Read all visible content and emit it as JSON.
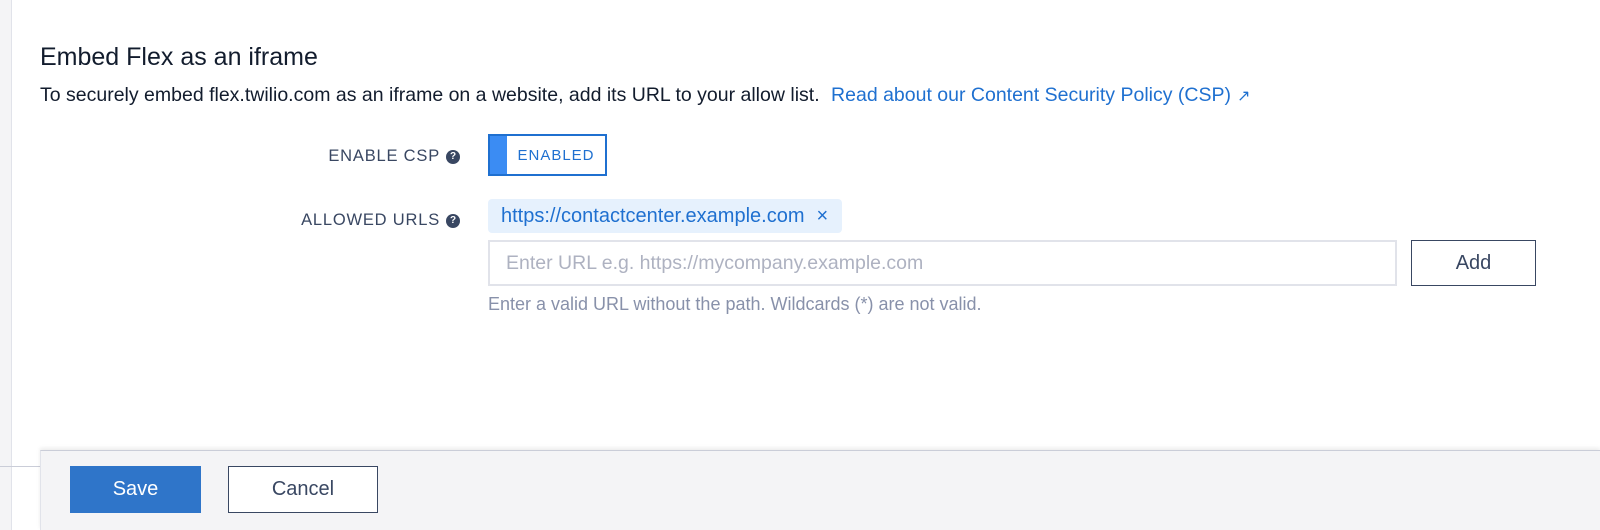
{
  "section": {
    "title": "Embed Flex as an iframe",
    "description": "To securely embed flex.twilio.com as an iframe on a website, add its URL to your allow list.",
    "csp_link_label": "Read about our Content Security Policy (CSP)",
    "external_link_icon": "↗"
  },
  "csp": {
    "label": "ENABLE CSP",
    "help_icon": "?",
    "toggle_label": "ENABLED",
    "enabled": true
  },
  "allowed_urls": {
    "label": "ALLOWED URLS",
    "help_icon": "?",
    "chips": [
      {
        "label": "https://contactcenter.example.com"
      }
    ],
    "remove_icon": "×",
    "input_value": "",
    "input_placeholder": "Enter URL e.g. https://mycompany.example.com",
    "add_label": "Add",
    "helper_text": "Enter a valid URL without the path. Wildcards (*) are not valid."
  },
  "footer": {
    "save_label": "Save",
    "cancel_label": "Cancel"
  },
  "colors": {
    "link": "#1f70d0",
    "toggle_knob": "#3b8cf3",
    "chip_background": "#e6f1fd",
    "primary_button": "#2f75c9"
  }
}
